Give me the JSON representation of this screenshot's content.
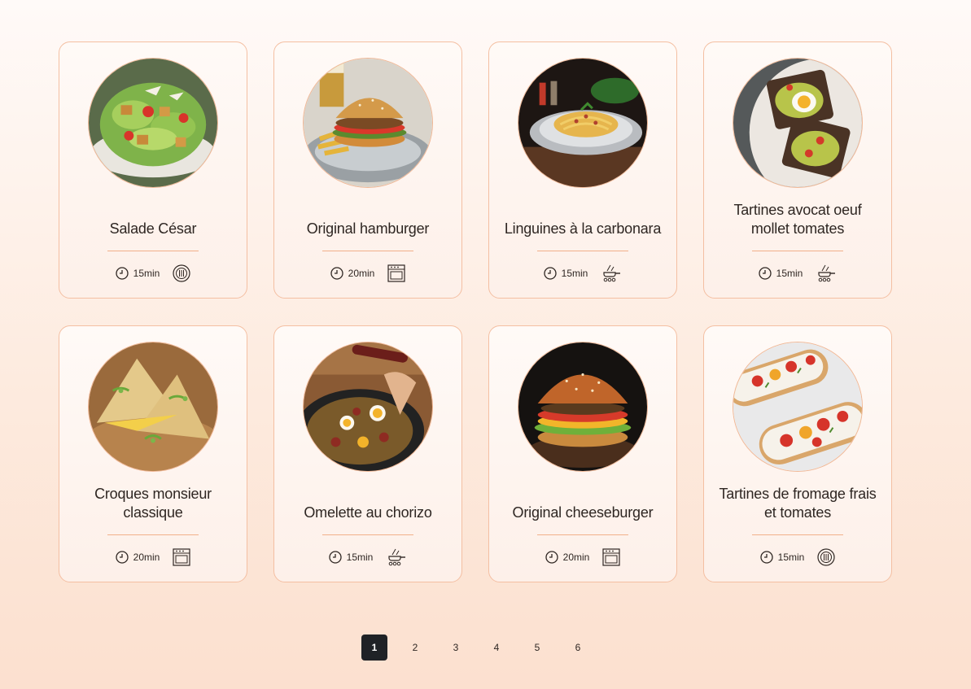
{
  "recipes": [
    {
      "title": "Salade César",
      "time": "15min",
      "method": "no-cook-icon",
      "photo": "salad"
    },
    {
      "title": "Original hamburger",
      "time": "20min",
      "method": "oven-icon",
      "photo": "burger"
    },
    {
      "title": "Linguines à la carbonara",
      "time": "15min",
      "method": "stovetop-icon",
      "photo": "pasta"
    },
    {
      "title": "Tartines avocat oeuf mollet tomates",
      "time": "15min",
      "method": "stovetop-icon",
      "photo": "toast"
    },
    {
      "title": "Croques monsieur classique",
      "time": "20min",
      "method": "oven-icon",
      "photo": "croque"
    },
    {
      "title": "Omelette au chorizo",
      "time": "15min",
      "method": "stovetop-icon",
      "photo": "omelette"
    },
    {
      "title": "Original cheeseburger",
      "time": "20min",
      "method": "oven-icon",
      "photo": "cheeseburger"
    },
    {
      "title": "Tartines de fromage frais et tomates",
      "time": "15min",
      "method": "no-cook-icon",
      "photo": "bruschetta"
    }
  ],
  "pagination": {
    "pages": [
      "1",
      "2",
      "3",
      "4",
      "5",
      "6"
    ],
    "current": "1"
  },
  "colors": {
    "accent": "#f1b08a",
    "card_border": "#f4bfa2",
    "active_page": "#1f2226"
  }
}
